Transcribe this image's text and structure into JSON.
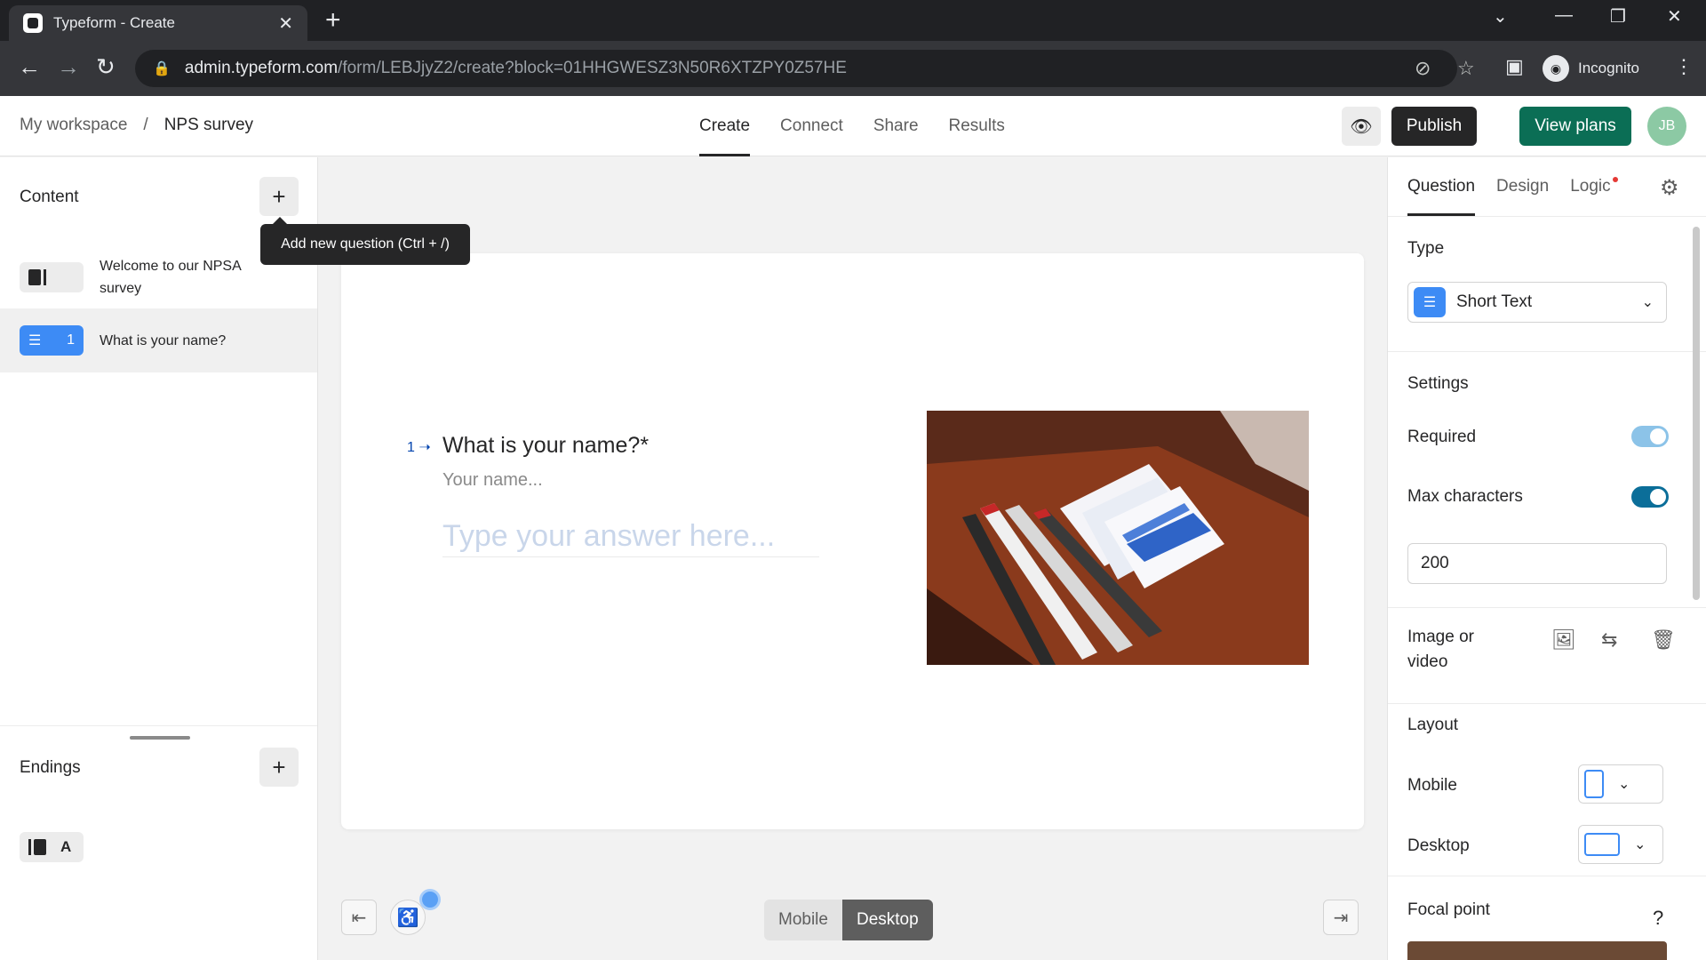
{
  "browser": {
    "tab_title": "Typeform - Create",
    "tab_close": "✕",
    "new_tab": "+",
    "url_host": "admin.typeform.com",
    "url_path": "/form/LEBJjyZ2/create?block=01HHGWESZ3N50R6XTZPY0Z57HE",
    "incognito_label": "Incognito"
  },
  "header": {
    "breadcrumb_workspace": "My workspace",
    "breadcrumb_sep": "/",
    "breadcrumb_form": "NPS survey",
    "tabs": [
      "Create",
      "Connect",
      "Share",
      "Results"
    ],
    "publish_label": "Publish",
    "view_plans_label": "View plans",
    "avatar_initials": "JB"
  },
  "left": {
    "content_title": "Content",
    "tooltip": "Add new question (Ctrl + /)",
    "items": [
      {
        "label": "Welcome to our NPSA survey",
        "number": ""
      },
      {
        "label": "What is your name?",
        "number": "1"
      }
    ],
    "endings_title": "Endings",
    "ending_item": "A"
  },
  "canvas": {
    "question_number": "1",
    "question_title": "What is your name?*",
    "question_description": "Your name...",
    "answer_placeholder": "Type your answer here...",
    "device_options": [
      "Mobile",
      "Desktop"
    ],
    "device_selected": "Desktop"
  },
  "right": {
    "tabs": [
      "Question",
      "Design",
      "Logic"
    ],
    "type_heading": "Type",
    "type_value": "Short Text",
    "settings_heading": "Settings",
    "required_label": "Required",
    "required_on": true,
    "max_chars_label": "Max characters",
    "max_chars_on": true,
    "max_chars_value": "200",
    "media_label": "Image or video",
    "layout_heading": "Layout",
    "layout_mobile_label": "Mobile",
    "layout_desktop_label": "Desktop",
    "focal_point_heading": "Focal point",
    "help": "?"
  },
  "colors": {
    "publish_bg": "#262627",
    "view_plans_bg": "#0b6e55",
    "type_icon_bg": "#3d8bf5",
    "toggle_on": "#0b6e99",
    "question_number": "#0445af"
  }
}
